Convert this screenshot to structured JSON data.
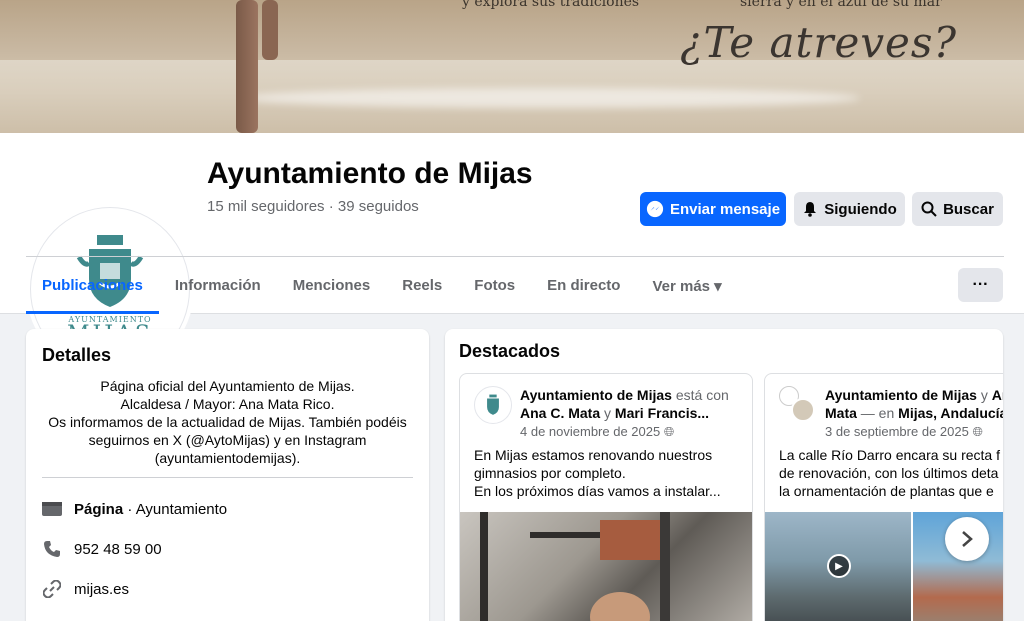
{
  "cover": {
    "line1": "y explora sus tradiciones",
    "line2": "sierra y en el azul de su mar",
    "slogan": "¿Te atreves?"
  },
  "profile": {
    "logo_text_top": "AYUNTAMIENTO",
    "logo_text_bottom": "MIJAS",
    "name": "Ayuntamiento de Mijas",
    "stats": "15 mil seguidores · 39 seguidos"
  },
  "actions": {
    "message": "Enviar mensaje",
    "following": "Siguiendo",
    "search": "Buscar"
  },
  "tabs": [
    {
      "label": "Publicaciones",
      "active": true
    },
    {
      "label": "Información"
    },
    {
      "label": "Menciones"
    },
    {
      "label": "Reels"
    },
    {
      "label": "Fotos"
    },
    {
      "label": "En directo"
    },
    {
      "label": "Ver más ▾"
    }
  ],
  "more_label": "···",
  "details": {
    "title": "Detalles",
    "bio": [
      "Página oficial del Ayuntamiento de Mijas.",
      "Alcaldesa / Mayor: Ana Mata Rico.",
      "Os informamos de la actualidad de Mijas. También podéis",
      "seguirnos en X (@AytoMijas) y en Instagram",
      "(ayuntamientodemijas)."
    ],
    "category_bold": "Página",
    "category_rest": " · Ayuntamiento",
    "phone": "952 48 59 00",
    "website": "mijas.es"
  },
  "featured": {
    "title": "Destacados",
    "posts": [
      {
        "author": "Ayuntamiento de Mijas",
        "connector": " está con ",
        "with1": "Ana C. Mata",
        "and": " y ",
        "with2": "Mari Francis...",
        "date": "4 de noviembre de 2025",
        "body": [
          "En Mijas estamos renovando nuestros",
          "gimnasios por completo.",
          "En los próximos días vamos a instalar..."
        ]
      },
      {
        "author": "Ayuntamiento de Mijas",
        "connector": " y ",
        "with1": "An",
        "line2a": "Mata",
        "line2b": " — en ",
        "location": "Mijas, Andalucía",
        "date": "3 de septiembre de 2025",
        "body": [
          "La calle Río Darro encara su recta f",
          "de renovación, con los últimos deta",
          "la ornamentación de plantas que e"
        ]
      }
    ]
  }
}
